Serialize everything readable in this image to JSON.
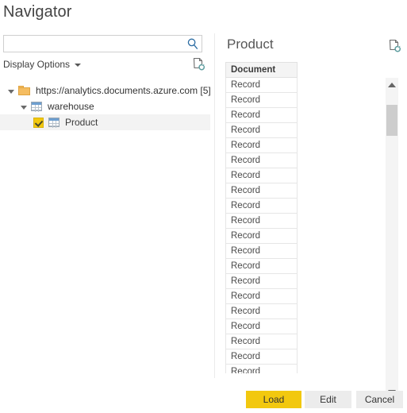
{
  "dialog": {
    "title": "Navigator"
  },
  "search": {
    "value": "",
    "placeholder": "",
    "icon": "search-icon"
  },
  "display_options": {
    "label": "Display Options",
    "caret_icon": "chevron-down-icon"
  },
  "left_refresh": {
    "icon": "refresh-document-icon"
  },
  "tree": {
    "items": [
      {
        "label": "https://analytics.documents.azure.com [5]",
        "level": 0,
        "icon": "folder-icon",
        "expanded": true,
        "selected": false,
        "checkbox": null
      },
      {
        "label": "warehouse",
        "level": 1,
        "icon": "table-icon",
        "expanded": true,
        "selected": false,
        "checkbox": null
      },
      {
        "label": "Product",
        "level": 2,
        "icon": "table-icon",
        "expanded": false,
        "selected": true,
        "checkbox": "checked"
      }
    ]
  },
  "preview": {
    "title": "Product",
    "refresh_icon": "refresh-document-icon",
    "columns": [
      "Document"
    ],
    "rows": [
      [
        "Record"
      ],
      [
        "Record"
      ],
      [
        "Record"
      ],
      [
        "Record"
      ],
      [
        "Record"
      ],
      [
        "Record"
      ],
      [
        "Record"
      ],
      [
        "Record"
      ],
      [
        "Record"
      ],
      [
        "Record"
      ],
      [
        "Record"
      ],
      [
        "Record"
      ],
      [
        "Record"
      ],
      [
        "Record"
      ],
      [
        "Record"
      ],
      [
        "Record"
      ],
      [
        "Record"
      ],
      [
        "Record"
      ],
      [
        "Record"
      ],
      [
        "Record"
      ]
    ],
    "scrollbar": {
      "up_icon": "chevron-up-icon",
      "down_icon": "chevron-down-icon",
      "thumb_position_percent": 5
    }
  },
  "footer": {
    "load_label": "Load",
    "edit_label": "Edit",
    "cancel_label": "Cancel"
  },
  "colors": {
    "accent_yellow": "#f2c80f",
    "button_gray": "#ececec",
    "folder_orange": "#f5bd61",
    "table_blue": "#6d9fd0",
    "search_icon_blue": "#2d6da3",
    "selected_row": "#f3f3f3"
  }
}
